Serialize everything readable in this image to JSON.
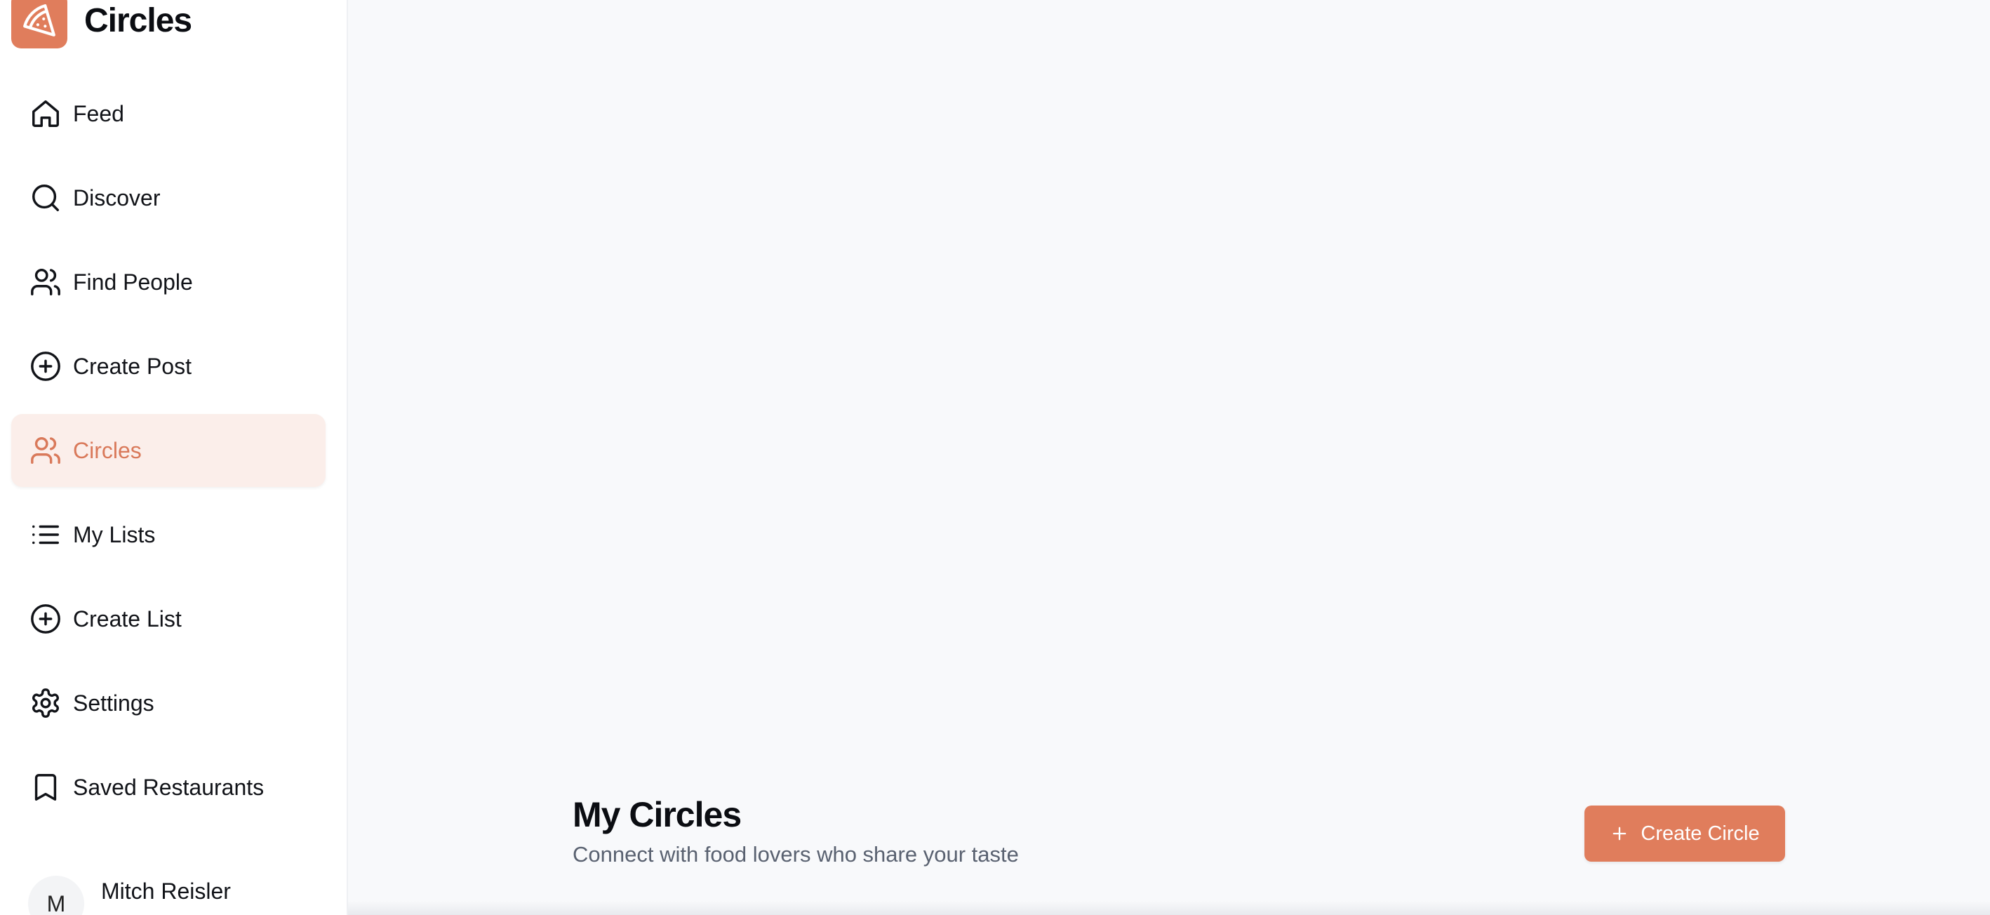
{
  "brand": {
    "name": "Circles",
    "accent_color": "#e07d5c"
  },
  "sidebar": {
    "items": [
      {
        "label": "Feed",
        "icon": "home-icon"
      },
      {
        "label": "Discover",
        "icon": "search-icon"
      },
      {
        "label": "Find People",
        "icon": "users-icon"
      },
      {
        "label": "Create Post",
        "icon": "plus-circle-icon"
      },
      {
        "label": "Circles",
        "icon": "users-icon",
        "active": true
      },
      {
        "label": "My Lists",
        "icon": "list-icon"
      },
      {
        "label": "Create List",
        "icon": "plus-circle-icon"
      },
      {
        "label": "Settings",
        "icon": "gear-icon"
      },
      {
        "label": "Saved Restaurants",
        "icon": "bookmark-icon"
      }
    ]
  },
  "user": {
    "initial": "M",
    "name": "Mitch Reisler"
  },
  "main": {
    "title": "My Circles",
    "subtitle": "Connect with food lovers who share your taste",
    "create_button_label": "Create Circle"
  }
}
